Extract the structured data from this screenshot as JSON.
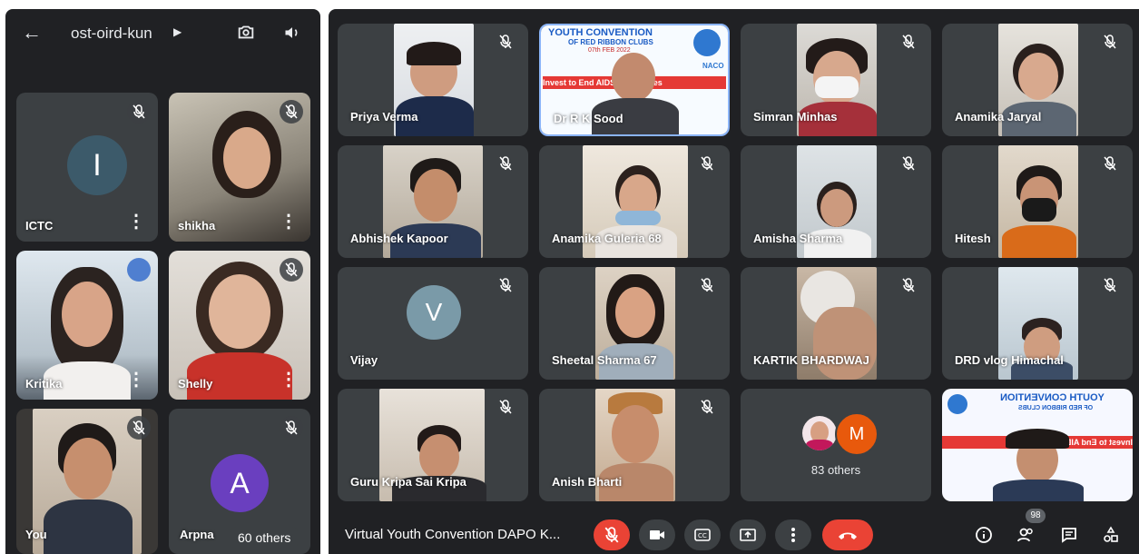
{
  "phone": {
    "meeting_code": "ost-oird-kun",
    "tiles": [
      {
        "name": "ICTC",
        "avatar_letter": "I"
      },
      {
        "name": "shikha"
      },
      {
        "name": "Kritika"
      },
      {
        "name": "Shelly"
      },
      {
        "name": "You"
      },
      {
        "name": "Arpna",
        "avatar_letter": "A",
        "others": "60 others"
      }
    ]
  },
  "meet": {
    "tiles": [
      {
        "name": "Priya Verma"
      },
      {
        "name": "Dr R K Sood",
        "banner_line1": "YOUTH CONVENTION",
        "banner_line2": "OF RED RIBBON CLUBS",
        "banner_date": "07th FEB 2022",
        "banner_slogan": "Invest to End AIDS, Save Lives",
        "banner_logo": "NACO"
      },
      {
        "name": "Simran Minhas"
      },
      {
        "name": "Anamika Jaryal"
      },
      {
        "name": "Abhishek Kapoor"
      },
      {
        "name": "Anamika Guleria 68"
      },
      {
        "name": "Amisha Sharma"
      },
      {
        "name": "Hitesh"
      },
      {
        "name": "Vijay",
        "avatar_letter": "V"
      },
      {
        "name": "Sheetal Sharma 67"
      },
      {
        "name": "KARTIK BHARDWAJ"
      },
      {
        "name": "DRD vlog Himachal"
      },
      {
        "name": "Guru Kripa Sai Kripa"
      },
      {
        "name": "Anish Bharti"
      },
      {
        "others_letter": "M",
        "others": "83 others"
      },
      {
        "banner_line1": "YOUTH CONVENTION",
        "banner_line2": "OF RED RIBBON CLUBS",
        "banner_slogan": "Invest to End AIDS"
      }
    ],
    "toolbar": {
      "meeting_title": "Virtual Youth Convention DAPO K...",
      "participant_count": "98"
    }
  },
  "colors": {
    "tile_bg": "#3c4043",
    "surface": "#202124",
    "end_call": "#ea4335",
    "avatar_I": "#3c5a6a",
    "avatar_A": "#6a3fbf",
    "avatar_V": "#7a9aa8",
    "avatar_M": "#e8590c"
  },
  "icons": [
    "back-arrow-icon",
    "switch-camera-icon",
    "speaker-icon",
    "mic-off-icon",
    "more-vert-icon",
    "camera-icon",
    "captions-icon",
    "present-icon",
    "end-call-icon",
    "info-icon",
    "people-icon",
    "chat-icon",
    "activities-icon"
  ]
}
